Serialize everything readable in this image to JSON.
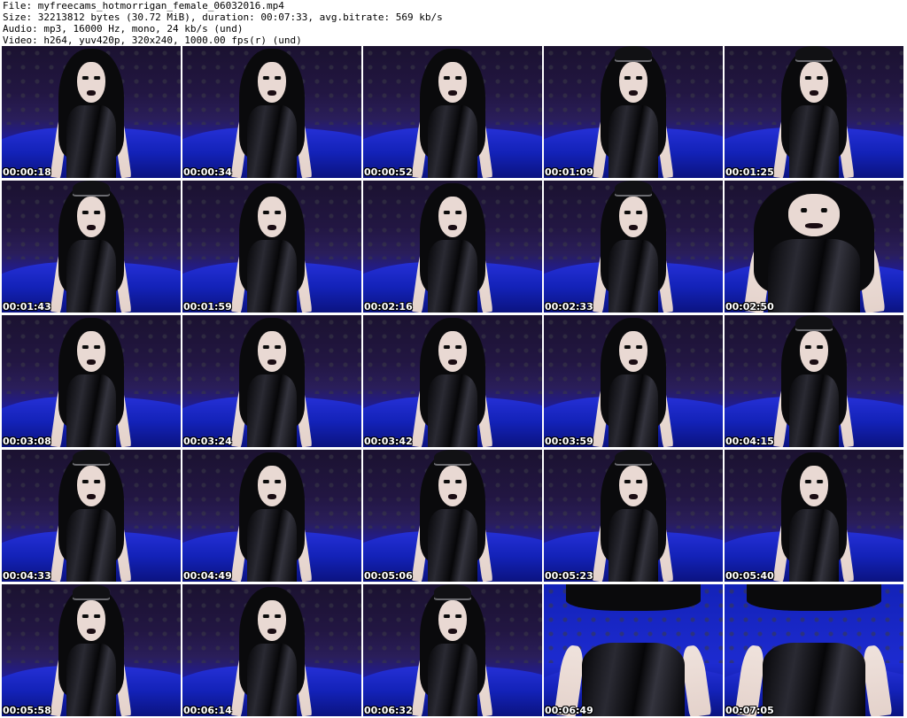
{
  "header": {
    "file_line": "File: myfreecams_hotmorrigan_female_06032016.mp4",
    "size_line": "Size: 32213812 bytes (30.72 MiB), duration: 00:07:33, avg.bitrate: 569 kb/s",
    "audio_line": "Audio: mp3, 16000 Hz, mono, 24 kb/s (und)",
    "video_line": "Video: h264, yuv420p, 320x240, 1000.00 fps(r) (und)"
  },
  "thumbnails": [
    {
      "timestamp": "00:00:18",
      "variant": "plain"
    },
    {
      "timestamp": "00:00:34",
      "variant": "plain"
    },
    {
      "timestamp": "00:00:52",
      "variant": "plain"
    },
    {
      "timestamp": "00:01:09",
      "variant": "cap"
    },
    {
      "timestamp": "00:01:25",
      "variant": "cap"
    },
    {
      "timestamp": "00:01:43",
      "variant": "cap"
    },
    {
      "timestamp": "00:01:59",
      "variant": "plain"
    },
    {
      "timestamp": "00:02:16",
      "variant": "plain"
    },
    {
      "timestamp": "00:02:33",
      "variant": "cap"
    },
    {
      "timestamp": "00:02:50",
      "variant": "close"
    },
    {
      "timestamp": "00:03:08",
      "variant": "plain"
    },
    {
      "timestamp": "00:03:24",
      "variant": "plain"
    },
    {
      "timestamp": "00:03:42",
      "variant": "plain"
    },
    {
      "timestamp": "00:03:59",
      "variant": "plain"
    },
    {
      "timestamp": "00:04:15",
      "variant": "cap"
    },
    {
      "timestamp": "00:04:33",
      "variant": "cap"
    },
    {
      "timestamp": "00:04:49",
      "variant": "plain"
    },
    {
      "timestamp": "00:05:06",
      "variant": "cap"
    },
    {
      "timestamp": "00:05:23",
      "variant": "cap"
    },
    {
      "timestamp": "00:05:40",
      "variant": "plain"
    },
    {
      "timestamp": "00:05:58",
      "variant": "cap"
    },
    {
      "timestamp": "00:06:14",
      "variant": "plain"
    },
    {
      "timestamp": "00:06:32",
      "variant": "cap"
    },
    {
      "timestamp": "00:06:49",
      "variant": "legs"
    },
    {
      "timestamp": "00:07:05",
      "variant": "legs"
    }
  ]
}
